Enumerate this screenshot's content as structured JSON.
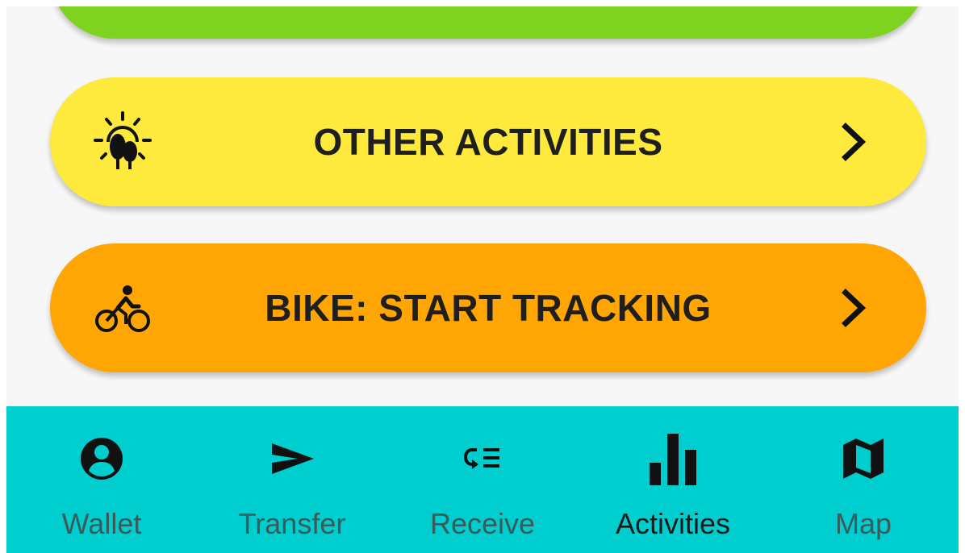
{
  "colors": {
    "green": "#7ed321",
    "yellow": "#fdea3c",
    "orange": "#ffa605",
    "teal": "#00cdcd",
    "text_dark": "#1f1f1f",
    "nav_inactive": "#3c5a5a"
  },
  "cards": [
    {
      "id": "top-green",
      "label": "",
      "icon": "none"
    },
    {
      "id": "other-activities",
      "label": "OTHER ACTIVITIES",
      "icon": "sun-trees-icon"
    },
    {
      "id": "bike-tracking",
      "label": "BIKE: START TRACKING",
      "icon": "bicycle-icon"
    }
  ],
  "nav": {
    "items": [
      {
        "label": "Wallet",
        "icon": "account-circle-icon",
        "active": false
      },
      {
        "label": "Transfer",
        "icon": "send-icon",
        "active": false
      },
      {
        "label": "Receive",
        "icon": "receive-icon",
        "active": false
      },
      {
        "label": "Activities",
        "icon": "bar-chart-icon",
        "active": true
      },
      {
        "label": "Map",
        "icon": "map-icon",
        "active": false
      }
    ]
  }
}
